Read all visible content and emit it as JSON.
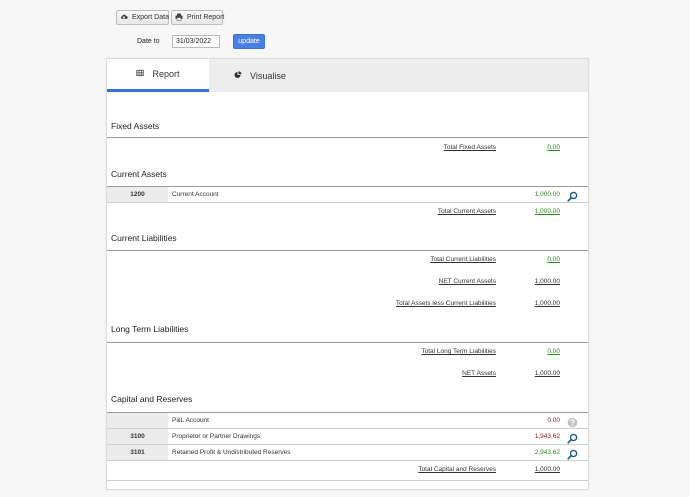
{
  "toolbar": {
    "export_label": "Export Data",
    "print_label": "Print Report"
  },
  "filter": {
    "date_label": "Date to",
    "date_value": "31/03/2022",
    "update_label": "update"
  },
  "tabs": {
    "report": "Report",
    "visualise": "Visualise"
  },
  "colors": {
    "accent": "#3a6fd8",
    "positive": "#2e8b1e",
    "negative": "#a11b1b"
  },
  "sections": {
    "fixed_assets": {
      "title": "Fixed Assets",
      "total_label": "Total Fixed Assets",
      "total_value": "0.00"
    },
    "current_assets": {
      "title": "Current Assets",
      "rows": [
        {
          "code": "1200",
          "name": "Current Account",
          "value": "1,000.00"
        }
      ],
      "total_label": "Total Current Assets",
      "total_value": "1,000.00"
    },
    "current_liabilities": {
      "title": "Current Liabilities",
      "total_label": "Total Current Liabilities",
      "total_value": "0.00",
      "net_label": "NET Current Assets",
      "net_value": "1,000.00",
      "assets_less_label": "Total Assets less Current Liabilities",
      "assets_less_value": "1,000.00"
    },
    "long_term_liabilities": {
      "title": "Long Term Liabilities",
      "total_label": "Total Long Term Liabilities",
      "total_value": "0.00",
      "net_label": "NET Assets",
      "net_value": "1,000.00"
    },
    "capital_reserves": {
      "title": "Capital and Reserves",
      "rows": [
        {
          "code": "",
          "name": "P&L Account",
          "value": "0.00"
        },
        {
          "code": "3100",
          "name": "Proprietor or Partner Drawings",
          "value": "1,943.62"
        },
        {
          "code": "3101",
          "name": "Retained Profit & Undistributed Reserves",
          "value": "2,943.62"
        }
      ],
      "total_label": "Total Capital and Reserves",
      "total_value": "1,000.00"
    }
  }
}
